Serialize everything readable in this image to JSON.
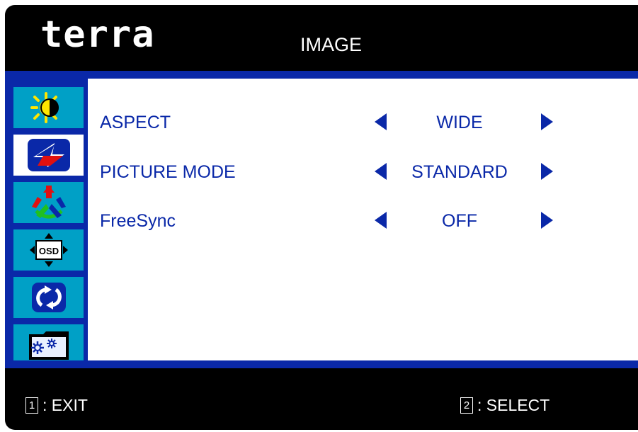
{
  "brand": "terra",
  "menu_title": "IMAGE",
  "sidebar": {
    "items": [
      {
        "icon": "brightness-contrast-icon",
        "selected": false
      },
      {
        "icon": "image-icon",
        "selected": true
      },
      {
        "icon": "color-icon",
        "selected": false
      },
      {
        "icon": "osd-icon",
        "label": "OSD",
        "selected": false
      },
      {
        "icon": "reset-icon",
        "selected": false
      },
      {
        "icon": "setup-icon",
        "selected": false
      }
    ]
  },
  "settings": [
    {
      "label": "ASPECT",
      "value": "WIDE"
    },
    {
      "label": "PICTURE MODE",
      "value": "STANDARD"
    },
    {
      "label": "FreeSync",
      "value": "OFF"
    }
  ],
  "footer": {
    "exit_key": "1",
    "exit_label": ": EXIT",
    "select_key": "2",
    "select_label": ": SELECT"
  },
  "colors": {
    "accent_blue": "#0a28a8",
    "tile_cyan": "#00a0c6",
    "background": "#000000",
    "panel": "#ffffff"
  }
}
